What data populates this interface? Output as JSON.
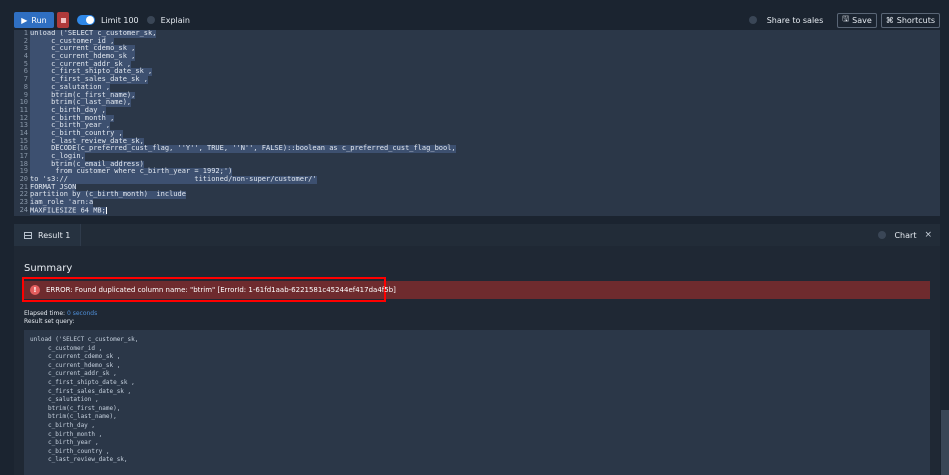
{
  "toolbar": {
    "run_label": "Run",
    "limit_label": "Limit 100",
    "explain_label": "Explain",
    "share_label": "Share to sales",
    "save_label": "Save",
    "shortcuts_label": "Shortcuts"
  },
  "editor": {
    "lines": [
      {
        "n": "1",
        "code": "unload ('SELECT c_customer_sk,",
        "sel": true
      },
      {
        "n": "2",
        "code": "     c_customer_id ,",
        "sel": true
      },
      {
        "n": "3",
        "code": "     c_current_cdemo_sk ,",
        "sel": true
      },
      {
        "n": "4",
        "code": "     c_current_hdemo_sk ,",
        "sel": true
      },
      {
        "n": "5",
        "code": "     c_current_addr_sk ,",
        "sel": true
      },
      {
        "n": "6",
        "code": "     c_first_shipto_date_sk ,",
        "sel": true
      },
      {
        "n": "7",
        "code": "     c_first_sales_date_sk ,",
        "sel": true
      },
      {
        "n": "8",
        "code": "     c_salutation ,",
        "sel": true
      },
      {
        "n": "9",
        "code": "     btrim(c_first_name),",
        "sel": true
      },
      {
        "n": "10",
        "code": "     btrim(c_last_name),",
        "sel": true
      },
      {
        "n": "11",
        "code": "     c_birth_day ,",
        "sel": true
      },
      {
        "n": "12",
        "code": "     c_birth_month ,",
        "sel": true
      },
      {
        "n": "13",
        "code": "     c_birth_year ,",
        "sel": true
      },
      {
        "n": "14",
        "code": "     c_birth_country ,",
        "sel": true
      },
      {
        "n": "15",
        "code": "     c_last_review_date_sk,",
        "sel": true
      },
      {
        "n": "16",
        "code": "     DECODE(c_preferred_cust_flag, ''Y'', TRUE, ''N'', FALSE)::boolean as c_preferred_cust_flag_bool,",
        "sel": true
      },
      {
        "n": "17",
        "code": "     c_login,",
        "sel": true
      },
      {
        "n": "18",
        "code": "     btrim(c_email_address)",
        "sel": true
      },
      {
        "n": "19",
        "code": "      from customer where c_birth_year = 1992;')",
        "sel": true
      },
      {
        "n": "20",
        "code": "to 's3://                              titioned/non-super/customer/'",
        "sel": true
      },
      {
        "n": "21",
        "code": "FORMAT JSON",
        "sel": true
      },
      {
        "n": "22",
        "code": "partition by (c_birth_month)  include",
        "sel": true
      },
      {
        "n": "23",
        "code": "iam_role 'arn:a",
        "sel": true
      },
      {
        "n": "24",
        "code": "MAXFILESIZE 64 MB;",
        "sel": true
      }
    ]
  },
  "result": {
    "tab_label": "Result 1",
    "chart_label": "Chart",
    "close_label": "×",
    "summary_title": "Summary",
    "error_message": "ERROR: Found duplicated column name: \"btrim\" [ErrorId: 1-61fd1aab-6221581c45244ef417da4f5b]",
    "elapsed_label": "Elapsed time:",
    "elapsed_value": "0 seconds",
    "result_set_label": "Result set query:",
    "query_lines": [
      "unload ('SELECT c_customer_sk,",
      "     c_customer_id ,",
      "     c_current_cdemo_sk ,",
      "     c_current_hdemo_sk ,",
      "     c_current_addr_sk ,",
      "     c_first_shipto_date_sk ,",
      "     c_first_sales_date_sk ,",
      "     c_salutation ,",
      "     btrim(c_first_name),",
      "     btrim(c_last_name),",
      "     c_birth_day ,",
      "     c_birth_month ,",
      "     c_birth_year ,",
      "     c_birth_country ,",
      "     c_last_review_date_sk,"
    ]
  },
  "colors": {
    "run_button": "#2f6fc2",
    "error_band": "#6e2b2e",
    "highlight_border": "#ff0000"
  }
}
